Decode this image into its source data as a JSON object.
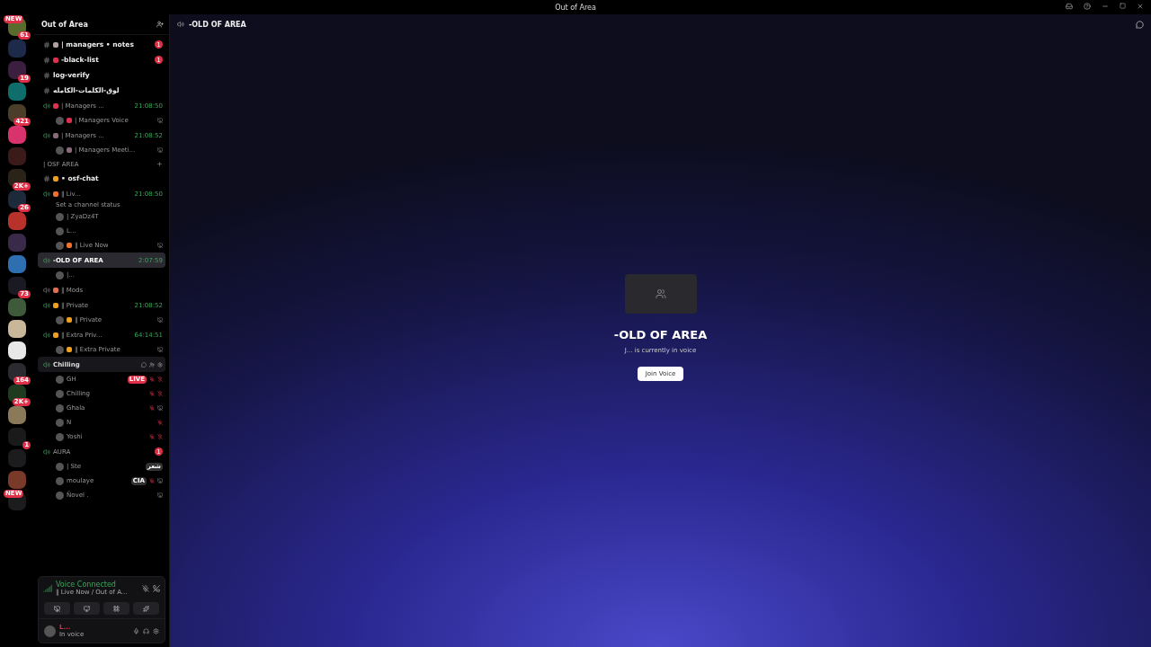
{
  "window": {
    "title": "Out of Area"
  },
  "servers": [
    {
      "color": "#5a6b2e",
      "badge": "61",
      "new": "NEW"
    },
    {
      "color": "#1e2a4a"
    },
    {
      "color": "#3a1f3f",
      "badge": "19"
    },
    {
      "color": "#0f6d6b"
    },
    {
      "color": "#4a3d2a",
      "badge": "421"
    },
    {
      "color": "#d9336e"
    },
    {
      "color": "#3b1a1a"
    },
    {
      "color": "#2a2418",
      "badge": "2K+"
    },
    {
      "color": "#1c2a3a",
      "badge": "26"
    },
    {
      "color": "#b8322b"
    },
    {
      "color": "#3a2a4a"
    },
    {
      "color": "#2d6fb0"
    },
    {
      "color": "#1a1a22",
      "badge": "73"
    },
    {
      "color": "#3f5a3a"
    },
    {
      "color": "#c9b79a"
    },
    {
      "color": "#e8e8e8"
    },
    {
      "color": "#2a2a30",
      "badge": "164"
    },
    {
      "color": "#203a20",
      "badge": "2K+"
    },
    {
      "color": "#8a7a5a"
    },
    {
      "color": "#1a1a1a",
      "badge": "1"
    },
    {
      "color": "#1c1c1f"
    },
    {
      "color": "#7a3a2a"
    },
    {
      "color": "#1c1c1f",
      "new": "NEW"
    }
  ],
  "server": {
    "name": "Out of Area"
  },
  "channels": [
    {
      "kind": "text",
      "name": "| managers • notes",
      "badge": "1",
      "color": "#b0a0a0"
    },
    {
      "kind": "text",
      "name": "-black-list",
      "badge": "1",
      "color": "#e03050"
    },
    {
      "kind": "text",
      "name": "log-verify"
    },
    {
      "kind": "text",
      "name": "لوق-الكلمات-الكامله"
    },
    {
      "kind": "voice",
      "name": "| Managers ...",
      "time": "21:08:50",
      "color": "#e03050",
      "active": true,
      "selected": false,
      "hovered": false
    },
    {
      "kind": "user",
      "name": "| Managers Voice",
      "color": "#e03050",
      "stream": true
    },
    {
      "kind": "voice",
      "name": "| Managers ...",
      "time": "21:08:52",
      "color": "#8a6a7a",
      "active": true,
      "selected": false,
      "hovered": false
    },
    {
      "kind": "user",
      "name": "| Managers Meeti...",
      "color": "#8a6a7a",
      "stream": true
    },
    {
      "kind": "category",
      "name": "| OSF AREA"
    },
    {
      "kind": "text",
      "name": "• osf-chat",
      "color": "#f0a020"
    },
    {
      "kind": "voice",
      "name": "‖ Liv...",
      "time": "21:08:50",
      "color": "#f07030",
      "active": true,
      "selected": false,
      "hovered": false,
      "status": "Set a channel status"
    },
    {
      "kind": "user",
      "name": "| ZyaDz4T"
    },
    {
      "kind": "user",
      "name": "L..."
    },
    {
      "kind": "user",
      "name": "‖ Live Now",
      "color": "#f07030",
      "stream": true
    },
    {
      "kind": "voice",
      "name": "-OLD OF AREA",
      "time": "2:07:59",
      "active": true,
      "selected": true,
      "hovered": false
    },
    {
      "kind": "user",
      "name": "|..."
    },
    {
      "kind": "voice",
      "name": "‖ Mods",
      "color": "#e07050",
      "active": false,
      "selected": false,
      "hovered": false
    },
    {
      "kind": "voice",
      "name": "‖ Private",
      "time": "21:08:52",
      "color": "#f0a020",
      "active": true,
      "selected": false,
      "hovered": false
    },
    {
      "kind": "user",
      "name": "‖ Private",
      "color": "#f0a020",
      "stream": true
    },
    {
      "kind": "voice",
      "name": "‖ Extra Priv...",
      "time": "64:14:51",
      "color": "#f0a020",
      "active": true,
      "selected": false,
      "hovered": false
    },
    {
      "kind": "user",
      "name": "‖ Extra Private",
      "color": "#f0a020",
      "stream": true
    },
    {
      "kind": "voice",
      "name": "Chilling",
      "active": true,
      "selected": false,
      "hovered": true
    },
    {
      "kind": "user",
      "name": "GH",
      "muted": true,
      "deafened": true,
      "tag": "LIVE",
      "live": true
    },
    {
      "kind": "user",
      "name": "Chilling",
      "muted": true,
      "deafened": true
    },
    {
      "kind": "user",
      "name": "Ghala",
      "muted": true,
      "stream": true
    },
    {
      "kind": "user",
      "name": "N",
      "muted": true
    },
    {
      "kind": "user",
      "name": "Yoshi",
      "muted": true,
      "deafened": true
    },
    {
      "kind": "voice",
      "name": "AURA",
      "active": true,
      "selected": false,
      "hovered": false,
      "badge": "1"
    },
    {
      "kind": "user",
      "name": "| Ste",
      "tag": "شعر",
      "live": false
    },
    {
      "kind": "user",
      "name": "moulaye",
      "tag": "CIA",
      "live": false,
      "muted": true,
      "stream": true
    },
    {
      "kind": "user",
      "name": "Ñovel .",
      "stream": true
    }
  ],
  "voice_panel": {
    "status": "Voice Connected",
    "location": "‖ Live Now / Out of A..."
  },
  "user_panel": {
    "name": "L...",
    "status": "In voice"
  },
  "main": {
    "channel": "-OLD OF AREA",
    "title": "-OLD OF AREA",
    "subtitle": "J... is currently in voice",
    "button": "Join Voice"
  }
}
